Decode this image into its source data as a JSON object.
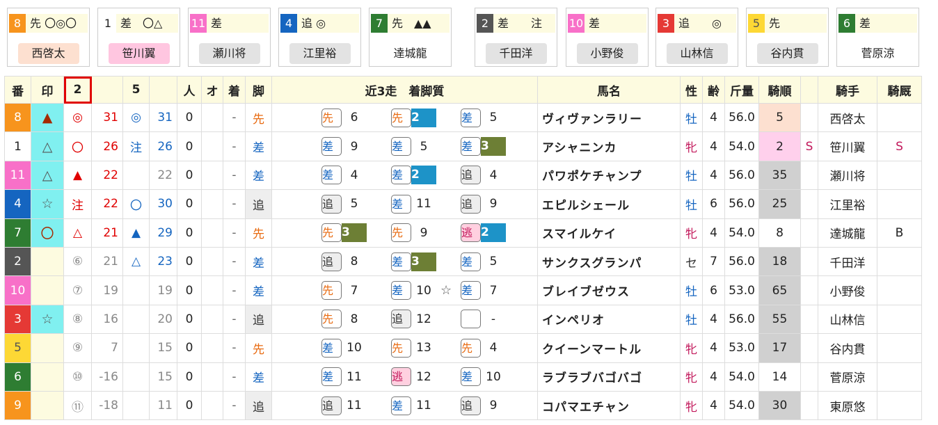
{
  "colors": {
    "header_bg": "#fdfbe0",
    "ps_blue": "#1d93c8",
    "ps_olive": "#6d7f35",
    "mark_cyan": "#80f0f0",
    "highlight_red": "#e00000"
  },
  "cards": [
    {
      "num": "8",
      "info": "先 〇◎〇",
      "name": "西啓太",
      "num_bg": "#f7941d",
      "num_fg": "#fff",
      "name_bg": "#fde0d0"
    },
    {
      "num": "1",
      "info": "差　〇△",
      "name": "笹川翼",
      "num_bg": "#fff",
      "num_fg": "#222",
      "name_bg": "#ffc6e0"
    },
    {
      "num": "11",
      "info": "差",
      "name": "瀬川将",
      "num_bg": "#f870c8",
      "num_fg": "#fff",
      "name_bg": "#e3e3e3"
    },
    {
      "num": "4",
      "info": "追 ◎",
      "name": "江里裕",
      "num_bg": "#1565c0",
      "num_fg": "#fff",
      "name_bg": "#e3e3e3"
    },
    {
      "num": "7",
      "info": "先　▲▲",
      "name": "達城龍",
      "num_bg": "#2e7d32",
      "num_fg": "#fff",
      "name_bg": "#ffffff"
    },
    {
      "num": "2",
      "info": "差　　注",
      "name": "千田洋",
      "num_bg": "#555",
      "num_fg": "#fff",
      "name_bg": "#e3e3e3"
    },
    {
      "num": "10",
      "info": "差",
      "name": "小野俊",
      "num_bg": "#f870c8",
      "num_fg": "#fff",
      "name_bg": "#e3e3e3"
    },
    {
      "num": "3",
      "info": "追　　◎",
      "name": "山林信",
      "num_bg": "#e53935",
      "num_fg": "#fff",
      "name_bg": "#e3e3e3"
    },
    {
      "num": "5",
      "info": "先",
      "name": "谷内貫",
      "num_bg": "#fdd835",
      "num_fg": "#555",
      "name_bg": "#e3e3e3"
    },
    {
      "num": "6",
      "info": "差",
      "name": "菅原涼",
      "num_bg": "#2e7d32",
      "num_fg": "#fff",
      "name_bg": "#ffffff"
    }
  ],
  "headers": [
    "番",
    "印",
    "2",
    "",
    "5",
    "",
    "人",
    "オ",
    "着",
    "脚",
    "近3走　着脚質",
    "馬名",
    "性",
    "齢",
    "斤量",
    "騎順",
    "",
    "騎手",
    "騎厩"
  ],
  "rows": [
    {
      "num": "8",
      "num_bg": "#f7941d",
      "num_fg": "#fff",
      "mark": "▲",
      "mark_color": "#a52a00",
      "mark_bg": "#80f0f0",
      "s1": "◎",
      "s1c": "#e00000",
      "v1": "31",
      "v1c": "#e00000",
      "s2": "◎",
      "s2c": "#1565c0",
      "v2": "31",
      "v2c": "#1565c0",
      "p": "0",
      "o": "",
      "f": "-",
      "leg": "先",
      "legc": "#e86a10",
      "legbg": "",
      "r": [
        {
          "t": "先",
          "c": "#e86a10",
          "bg": "#fff",
          "n": "6",
          "ps": ""
        },
        {
          "t": "先",
          "c": "#e86a10",
          "bg": "#fff",
          "n": "2",
          "ps": "blue"
        },
        {
          "t": "差",
          "c": "#1565c0",
          "bg": "#fff",
          "n": "5",
          "ps": ""
        }
      ],
      "star": "",
      "name": "ヴィヴァンラリー",
      "sex": "牡",
      "sexc": "#1565c0",
      "age": "4",
      "wt": "56.0",
      "rank": "5",
      "rankbg": "#fde0d0",
      "ex": "",
      "jockey": "西啓太",
      "stable": ""
    },
    {
      "num": "1",
      "num_bg": "#fff",
      "num_fg": "#222",
      "mark": "△",
      "mark_color": "#555",
      "mark_bg": "#80f0f0",
      "s1": "〇",
      "s1c": "#e00000",
      "v1": "26",
      "v1c": "#e00000",
      "s2": "注",
      "s2c": "#1565c0",
      "v2": "26",
      "v2c": "#1565c0",
      "p": "0",
      "o": "",
      "f": "-",
      "leg": "差",
      "legc": "#1565c0",
      "legbg": "",
      "r": [
        {
          "t": "差",
          "c": "#1565c0",
          "bg": "#fff",
          "n": "9",
          "ps": ""
        },
        {
          "t": "差",
          "c": "#1565c0",
          "bg": "#fff",
          "n": "5",
          "ps": ""
        },
        {
          "t": "差",
          "c": "#1565c0",
          "bg": "#fff",
          "n": "3",
          "ps": "olive"
        }
      ],
      "star": "",
      "name": "アシャニンカ",
      "sex": "牝",
      "sexc": "#c2185b",
      "age": "4",
      "wt": "54.0",
      "rank": "2",
      "rankbg": "#ffd0ec",
      "ex": "S",
      "jockey": "笹川翼",
      "stable": "S"
    },
    {
      "num": "11",
      "num_bg": "#f870c8",
      "num_fg": "#fff",
      "mark": "△",
      "mark_color": "#555",
      "mark_bg": "#80f0f0",
      "s1": "▲",
      "s1c": "#e00000",
      "v1": "22",
      "v1c": "#e00000",
      "s2": "",
      "s2c": "#1565c0",
      "v2": "22",
      "v2c": "#888",
      "p": "0",
      "o": "",
      "f": "-",
      "leg": "差",
      "legc": "#1565c0",
      "legbg": "",
      "r": [
        {
          "t": "差",
          "c": "#1565c0",
          "bg": "#fff",
          "n": "4",
          "ps": ""
        },
        {
          "t": "差",
          "c": "#1565c0",
          "bg": "#fff",
          "n": "2",
          "ps": "blue"
        },
        {
          "t": "追",
          "c": "#333",
          "bg": "#eee",
          "n": "4",
          "ps": ""
        }
      ],
      "star": "",
      "name": "パワポケチャンプ",
      "sex": "牡",
      "sexc": "#1565c0",
      "age": "4",
      "wt": "56.0",
      "rank": "35",
      "rankbg": "#d0d0d0",
      "ex": "",
      "jockey": "瀬川将",
      "stable": ""
    },
    {
      "num": "4",
      "num_bg": "#1565c0",
      "num_fg": "#fff",
      "mark": "☆",
      "mark_color": "#555",
      "mark_bg": "#80f0f0",
      "s1": "注",
      "s1c": "#e00000",
      "v1": "22",
      "v1c": "#e00000",
      "s2": "〇",
      "s2c": "#1565c0",
      "v2": "30",
      "v2c": "#1565c0",
      "p": "0",
      "o": "",
      "f": "-",
      "leg": "追",
      "legc": "#333",
      "legbg": "#eee",
      "r": [
        {
          "t": "追",
          "c": "#333",
          "bg": "#eee",
          "n": "5",
          "ps": ""
        },
        {
          "t": "差",
          "c": "#1565c0",
          "bg": "#fff",
          "n": "11",
          "ps": ""
        },
        {
          "t": "追",
          "c": "#333",
          "bg": "#eee",
          "n": "9",
          "ps": ""
        }
      ],
      "star": "",
      "name": "エピルシェール",
      "sex": "牡",
      "sexc": "#1565c0",
      "age": "6",
      "wt": "56.0",
      "rank": "25",
      "rankbg": "#d0d0d0",
      "ex": "",
      "jockey": "江里裕",
      "stable": ""
    },
    {
      "num": "7",
      "num_bg": "#2e7d32",
      "num_fg": "#fff",
      "mark": "〇",
      "mark_color": "#a52a00",
      "mark_bg": "#80f0f0",
      "s1": "△",
      "s1c": "#e00000",
      "v1": "21",
      "v1c": "#e00000",
      "s2": "▲",
      "s2c": "#1565c0",
      "v2": "29",
      "v2c": "#1565c0",
      "p": "0",
      "o": "",
      "f": "-",
      "leg": "先",
      "legc": "#e86a10",
      "legbg": "",
      "r": [
        {
          "t": "先",
          "c": "#e86a10",
          "bg": "#fff",
          "n": "3",
          "ps": "olive"
        },
        {
          "t": "先",
          "c": "#e86a10",
          "bg": "#fff",
          "n": "9",
          "ps": ""
        },
        {
          "t": "逃",
          "c": "#c2185b",
          "bg": "#ffd0e0",
          "n": "2",
          "ps": "blue"
        }
      ],
      "star": "",
      "name": "スマイルケイ",
      "sex": "牝",
      "sexc": "#c2185b",
      "age": "4",
      "wt": "54.0",
      "rank": "8",
      "rankbg": "",
      "ex": "",
      "jockey": "達城龍",
      "stable": "B"
    },
    {
      "num": "2",
      "num_bg": "#555",
      "num_fg": "#fff",
      "mark": "",
      "mark_color": "#555",
      "mark_bg": "#fdfbe0",
      "s1": "⑥",
      "s1c": "#888",
      "v1": "21",
      "v1c": "#888",
      "s2": "△",
      "s2c": "#1565c0",
      "v2": "23",
      "v2c": "#1565c0",
      "p": "0",
      "o": "",
      "f": "-",
      "leg": "差",
      "legc": "#1565c0",
      "legbg": "",
      "r": [
        {
          "t": "追",
          "c": "#333",
          "bg": "#eee",
          "n": "8",
          "ps": ""
        },
        {
          "t": "差",
          "c": "#1565c0",
          "bg": "#fff",
          "n": "3",
          "ps": "olive"
        },
        {
          "t": "差",
          "c": "#1565c0",
          "bg": "#fff",
          "n": "5",
          "ps": ""
        }
      ],
      "star": "",
      "name": "サンクスグランパ",
      "sex": "セ",
      "sexc": "#333",
      "age": "7",
      "wt": "56.0",
      "rank": "18",
      "rankbg": "#d0d0d0",
      "ex": "",
      "jockey": "千田洋",
      "stable": ""
    },
    {
      "num": "10",
      "num_bg": "#f870c8",
      "num_fg": "#fff",
      "mark": "",
      "mark_color": "#555",
      "mark_bg": "#fdfbe0",
      "s1": "⑦",
      "s1c": "#888",
      "v1": "19",
      "v1c": "#888",
      "s2": "",
      "s2c": "#888",
      "v2": "19",
      "v2c": "#888",
      "p": "0",
      "o": "",
      "f": "-",
      "leg": "差",
      "legc": "#1565c0",
      "legbg": "",
      "r": [
        {
          "t": "先",
          "c": "#e86a10",
          "bg": "#fff",
          "n": "7",
          "ps": ""
        },
        {
          "t": "差",
          "c": "#1565c0",
          "bg": "#fff",
          "n": "10",
          "ps": ""
        },
        {
          "t": "差",
          "c": "#1565c0",
          "bg": "#fff",
          "n": "7",
          "ps": ""
        }
      ],
      "star": "☆",
      "name": "ブレイブゼウス",
      "sex": "牡",
      "sexc": "#1565c0",
      "age": "6",
      "wt": "53.0",
      "rank": "65",
      "rankbg": "#d0d0d0",
      "ex": "",
      "jockey": "小野俊",
      "stable": ""
    },
    {
      "num": "3",
      "num_bg": "#e53935",
      "num_fg": "#fff",
      "mark": "☆",
      "mark_color": "#555",
      "mark_bg": "#80f0f0",
      "s1": "⑧",
      "s1c": "#888",
      "v1": "16",
      "v1c": "#888",
      "s2": "",
      "s2c": "#888",
      "v2": "20",
      "v2c": "#888",
      "p": "0",
      "o": "",
      "f": "-",
      "leg": "追",
      "legc": "#333",
      "legbg": "#eee",
      "r": [
        {
          "t": "先",
          "c": "#e86a10",
          "bg": "#fff",
          "n": "8",
          "ps": ""
        },
        {
          "t": "追",
          "c": "#333",
          "bg": "#eee",
          "n": "12",
          "ps": ""
        },
        {
          "t": "",
          "c": "#333",
          "bg": "#fff",
          "n": "-",
          "ps": ""
        }
      ],
      "star": "",
      "name": "インペリオ",
      "sex": "牡",
      "sexc": "#1565c0",
      "age": "4",
      "wt": "56.0",
      "rank": "55",
      "rankbg": "#d0d0d0",
      "ex": "",
      "jockey": "山林信",
      "stable": ""
    },
    {
      "num": "5",
      "num_bg": "#fdd835",
      "num_fg": "#555",
      "mark": "",
      "mark_color": "#555",
      "mark_bg": "#fdfbe0",
      "s1": "⑨",
      "s1c": "#888",
      "v1": "7",
      "v1c": "#888",
      "s2": "",
      "s2c": "#888",
      "v2": "15",
      "v2c": "#888",
      "p": "0",
      "o": "",
      "f": "-",
      "leg": "先",
      "legc": "#e86a10",
      "legbg": "",
      "r": [
        {
          "t": "差",
          "c": "#1565c0",
          "bg": "#fff",
          "n": "10",
          "ps": ""
        },
        {
          "t": "先",
          "c": "#e86a10",
          "bg": "#fff",
          "n": "13",
          "ps": ""
        },
        {
          "t": "先",
          "c": "#e86a10",
          "bg": "#fff",
          "n": "4",
          "ps": ""
        }
      ],
      "star": "",
      "name": "クイーンマートル",
      "sex": "牝",
      "sexc": "#c2185b",
      "age": "4",
      "wt": "53.0",
      "rank": "17",
      "rankbg": "#d0d0d0",
      "ex": "",
      "jockey": "谷内貫",
      "stable": ""
    },
    {
      "num": "6",
      "num_bg": "#2e7d32",
      "num_fg": "#fff",
      "mark": "",
      "mark_color": "#555",
      "mark_bg": "#fdfbe0",
      "s1": "⑩",
      "s1c": "#888",
      "v1": "-16",
      "v1c": "#888",
      "s2": "",
      "s2c": "#888",
      "v2": "15",
      "v2c": "#888",
      "p": "0",
      "o": "",
      "f": "-",
      "leg": "差",
      "legc": "#1565c0",
      "legbg": "",
      "r": [
        {
          "t": "差",
          "c": "#1565c0",
          "bg": "#fff",
          "n": "11",
          "ps": ""
        },
        {
          "t": "逃",
          "c": "#c2185b",
          "bg": "#ffd0e0",
          "n": "12",
          "ps": ""
        },
        {
          "t": "差",
          "c": "#1565c0",
          "bg": "#fff",
          "n": "10",
          "ps": ""
        }
      ],
      "star": "",
      "name": "ラブラブバゴバゴ",
      "sex": "牝",
      "sexc": "#c2185b",
      "age": "4",
      "wt": "54.0",
      "rank": "14",
      "rankbg": "",
      "ex": "",
      "jockey": "菅原涼",
      "stable": ""
    },
    {
      "num": "9",
      "num_bg": "#f7941d",
      "num_fg": "#fff",
      "mark": "",
      "mark_color": "#555",
      "mark_bg": "#fdfbe0",
      "s1": "⑪",
      "s1c": "#888",
      "v1": "-18",
      "v1c": "#888",
      "s2": "",
      "s2c": "#888",
      "v2": "11",
      "v2c": "#888",
      "p": "0",
      "o": "",
      "f": "-",
      "leg": "追",
      "legc": "#333",
      "legbg": "#eee",
      "r": [
        {
          "t": "追",
          "c": "#333",
          "bg": "#eee",
          "n": "11",
          "ps": ""
        },
        {
          "t": "差",
          "c": "#1565c0",
          "bg": "#fff",
          "n": "11",
          "ps": ""
        },
        {
          "t": "追",
          "c": "#333",
          "bg": "#eee",
          "n": "9",
          "ps": ""
        }
      ],
      "star": "",
      "name": "コパマエチャン",
      "sex": "牝",
      "sexc": "#c2185b",
      "age": "4",
      "wt": "54.0",
      "rank": "30",
      "rankbg": "#d0d0d0",
      "ex": "",
      "jockey": "東原悠",
      "stable": ""
    }
  ]
}
